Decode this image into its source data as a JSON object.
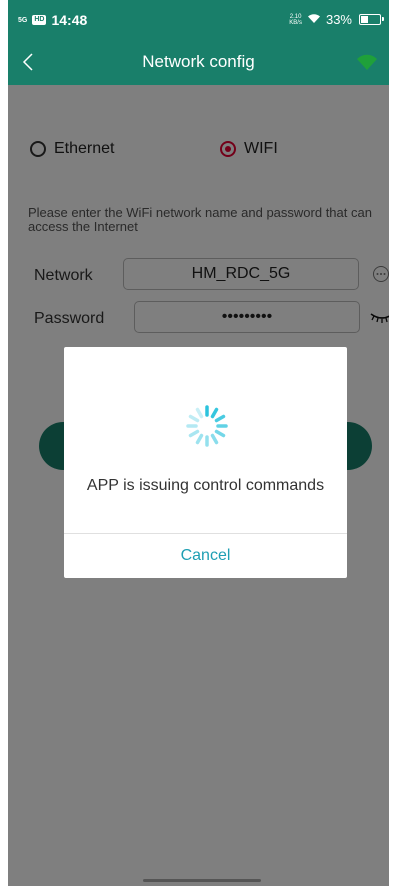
{
  "status_bar": {
    "network": "5G",
    "hd_badge": "HD",
    "time": "14:48",
    "speed_value": "2.10",
    "speed_unit": "KB/s",
    "battery": "33%",
    "battery_fraction": 0.33
  },
  "header": {
    "title": "Network config",
    "back_icon": "chevron-left-icon",
    "wifi_icon": "wifi-icon"
  },
  "form": {
    "options": [
      "Ethernet",
      "WIFI"
    ],
    "selected": "WIFI",
    "hint": "Please enter the WiFi network name and password that can access the Internet",
    "network_label": "Network",
    "network_value": "HM_RDC_5G",
    "password_label": "Password",
    "password_value": "•••••••••"
  },
  "dialog": {
    "message": "APP is issuing control commands",
    "cancel_label": "Cancel"
  },
  "colors": {
    "primary": "#197f6a",
    "radio_selected": "#e60033",
    "dialog_link": "#1e9fb3",
    "spinner": "#2bc3dd"
  }
}
